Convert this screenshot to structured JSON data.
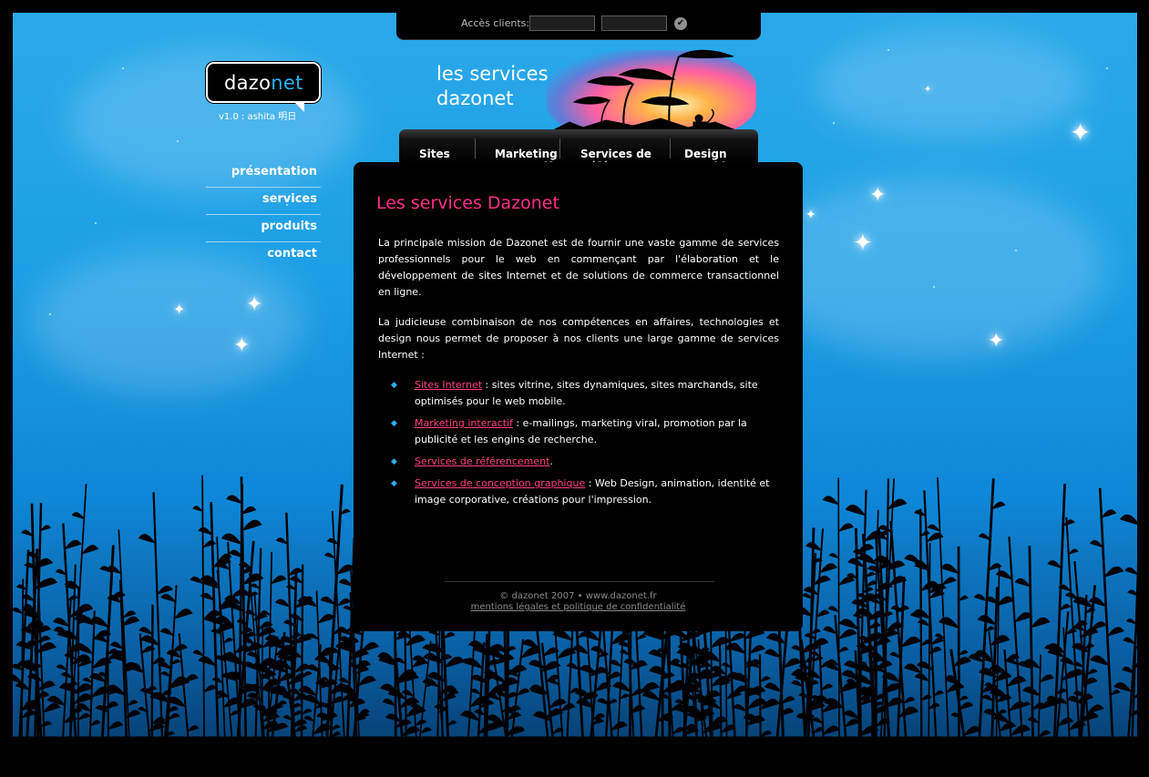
{
  "login": {
    "label": "Accès clients:",
    "user_value": "",
    "pass_value": "",
    "submit_icon": "check-circle-icon"
  },
  "logo": {
    "part1": "dazo",
    "part2": "net",
    "version": "v1.0 : ashita 明日"
  },
  "sidenav": {
    "items": [
      {
        "label": "présentation"
      },
      {
        "label": "services"
      },
      {
        "label": "produits"
      },
      {
        "label": "contact"
      }
    ]
  },
  "header": {
    "title_line1": "les services",
    "title_line2": "dazonet"
  },
  "tabs": [
    {
      "label": "Sites\nInternet"
    },
    {
      "label": "Marketing\nInteractif"
    },
    {
      "label": "Services de\nRéférencement"
    },
    {
      "label": "Design\nGraphique"
    }
  ],
  "content": {
    "heading": "Les services Dazonet",
    "para1": "La principale mission de Dazonet est de fournir une vaste gamme de services professionnels pour le web en commençant par l'élaboration et le développement de sites Internet et de solutions de commerce transactionnel en ligne.",
    "para2": "La judicieuse combinaison de nos compétences en affaires, technologies et design nous permet de proposer à nos clients une large gamme de services Internet :",
    "list": [
      {
        "link": "Sites Internet",
        "text": " : sites vitrine, sites dynamiques, sites marchands, site optimisés pour le web mobile."
      },
      {
        "link": "Marketing interactif",
        "text": " : e-mailings, marketing viral, promotion par la publicité et les engins de recherche."
      },
      {
        "link": "Services de référencement",
        "text": "."
      },
      {
        "link": "Services de conception graphique",
        "text": " : Web Design, animation, identité et image corporative, créations pour l'impression."
      }
    ]
  },
  "footer": {
    "copyright": "© dazonet 2007 • www.dazonet.fr",
    "legal_link": "mentions légales et politique de confidentialité"
  },
  "colors": {
    "accent_pink": "#ff2f8a",
    "accent_blue": "#25b2f2",
    "sky": "#1c9fe6"
  }
}
